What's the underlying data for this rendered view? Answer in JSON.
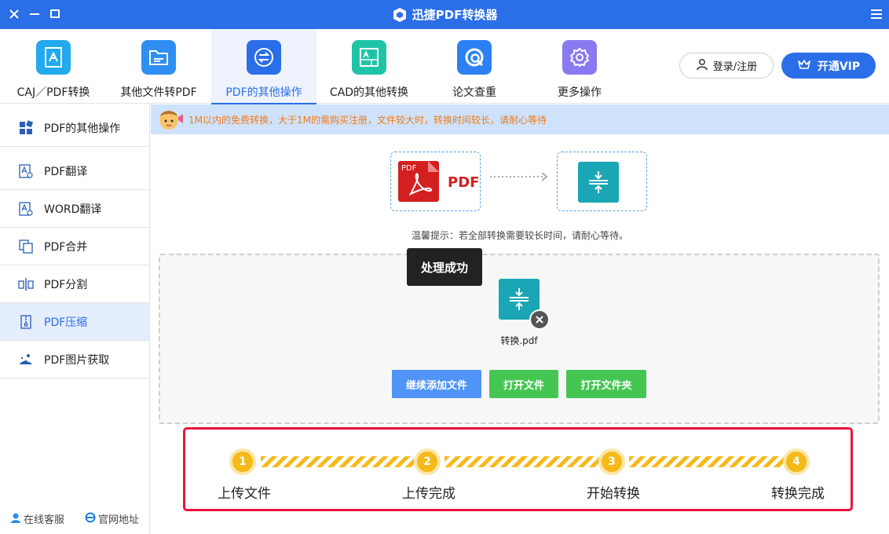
{
  "app": {
    "title": "迅捷PDF转换器"
  },
  "toolbar": {
    "items": [
      {
        "label": "CAJ／PDF转换",
        "color": "#23a9ee"
      },
      {
        "label": "其他文件转PDF",
        "color": "#2f8ef1"
      },
      {
        "label": "PDF的其他操作",
        "color": "#2a6ee8"
      },
      {
        "label": "CAD的其他转换",
        "color": "#1fc4a6"
      },
      {
        "label": "论文查重",
        "color": "#2d80f4"
      },
      {
        "label": "更多操作",
        "color": "#8a7af2"
      }
    ],
    "login_label": "登录/注册",
    "vip_label": "开通VIP"
  },
  "sidebar": {
    "items": [
      {
        "label": "PDF的其他操作"
      },
      {
        "label": "PDF翻译"
      },
      {
        "label": "WORD翻译"
      },
      {
        "label": "PDF合并"
      },
      {
        "label": "PDF分割"
      },
      {
        "label": "PDF压缩"
      },
      {
        "label": "PDF图片获取"
      }
    ],
    "footer": {
      "service_label": "在线客服",
      "website_label": "官网地址"
    }
  },
  "notice": {
    "text": "1M以内的免费转换，大于1M的需购买注册，文件较大时，转换时间较长，请耐心等待"
  },
  "flow": {
    "source_tag": "PDF",
    "source_label": "PDF"
  },
  "tip": {
    "text": "温馨提示：若全部转换需要较长时间，请耐心等待。"
  },
  "drop": {
    "toast": "处理成功",
    "file_name": "转换.pdf",
    "buttons": {
      "add": "继续添加文件",
      "open_file": "打开文件",
      "open_folder": "打开文件夹"
    }
  },
  "steps": [
    {
      "num": "1",
      "label": "上传文件"
    },
    {
      "num": "2",
      "label": "上传完成"
    },
    {
      "num": "3",
      "label": "开始转换"
    },
    {
      "num": "4",
      "label": "转换完成"
    }
  ],
  "colors": {
    "primary": "#2a6ee8",
    "add_button": "#4f94f6",
    "green_button": "#45c653",
    "step": "#f6b91a",
    "highlight_border": "#e8143c"
  }
}
